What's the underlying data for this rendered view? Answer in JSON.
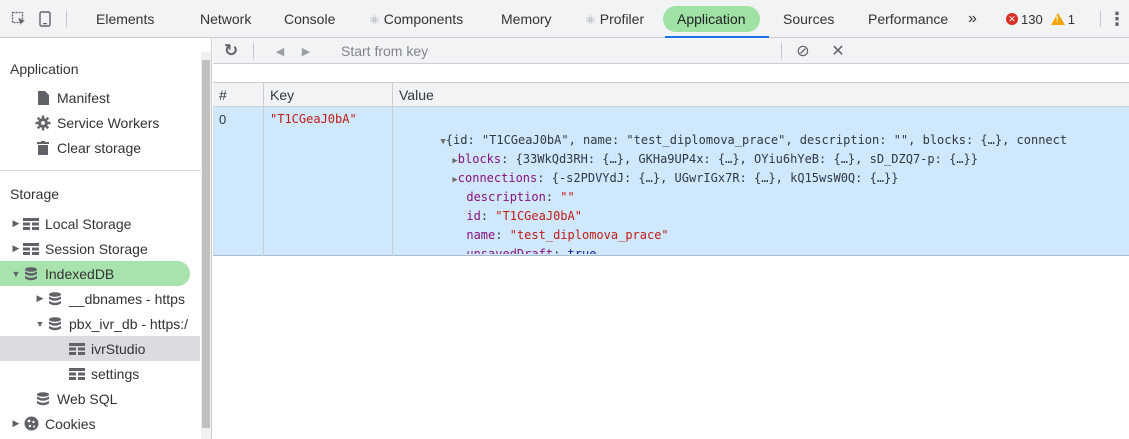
{
  "topbar": {
    "tabs": [
      {
        "label": "Elements"
      },
      {
        "label": "Network"
      },
      {
        "label": "Console"
      },
      {
        "label": "Components",
        "prefix": "⚛"
      },
      {
        "label": "Memory"
      },
      {
        "label": "Profiler",
        "prefix": "⚛"
      },
      {
        "label": "Application",
        "active": true
      },
      {
        "label": "Sources"
      },
      {
        "label": "Performance"
      }
    ],
    "more": "»",
    "errors_count": "130",
    "warnings_count": "1",
    "kebab": "⋮"
  },
  "sidebar": {
    "application_header": "Application",
    "application_items": [
      {
        "label": "Manifest",
        "icon": "file-icon"
      },
      {
        "label": "Service Workers",
        "icon": "gear-icon"
      },
      {
        "label": "Clear storage",
        "icon": "trash-icon"
      }
    ],
    "storage_header": "Storage",
    "storage_items": [
      {
        "label": "Local Storage",
        "icon": "table-icon",
        "arrow": "▶"
      },
      {
        "label": "Session Storage",
        "icon": "table-icon",
        "arrow": "▶"
      },
      {
        "label": "IndexedDB",
        "icon": "database-icon",
        "arrow": "▼",
        "selected": true
      },
      {
        "label": "__dbnames - https",
        "icon": "database-icon",
        "arrow": "▶"
      },
      {
        "label": "pbx_ivr_db - https:/",
        "icon": "database-icon",
        "arrow": "▼"
      },
      {
        "label": "ivrStudio",
        "icon": "table-icon"
      },
      {
        "label": "settings",
        "icon": "table-icon"
      },
      {
        "label": "Web SQL",
        "icon": "database-icon"
      },
      {
        "label": "Cookies",
        "icon": "cookie-icon",
        "arrow": "▶"
      }
    ]
  },
  "toolbar": {
    "refresh_icon": "↻",
    "prev_icon": "◀",
    "next_icon": "▶",
    "key_placeholder": "Start from key",
    "clear_icon": "⊘",
    "delete_icon": "✕"
  },
  "grid": {
    "headers": [
      "#",
      "Key",
      "Value"
    ],
    "row": {
      "index": "0",
      "key": "\"T1CGeaJ0bA\"",
      "value_lines": [
        {
          "arrow": "▼",
          "content": "{id: \"T1CGeaJ0bA\", name: \"test_diplomova_prace\", description: \"\", blocks: {…}, connect"
        },
        {
          "arrow": "▶",
          "prop": "blocks",
          "content": "{33WkQd3RH: {…}, GKHa9UP4x: {…}, OYiu6hYeB: {…}, sD_DZQ7-p: {…}}"
        },
        {
          "arrow": "▶",
          "prop": "connections",
          "content": "{-s2PDVYdJ: {…}, UGwrIGx7R: {…}, kQ15wsW0Q: {…}}"
        },
        {
          "prop": "description",
          "content": "\"\""
        },
        {
          "prop": "id",
          "content": "\"T1CGeaJ0bA\""
        },
        {
          "prop": "name",
          "content": "\"test_diplomova_prace\""
        },
        {
          "prop": "unsavedDraft",
          "content": "true"
        }
      ]
    }
  },
  "colors": {
    "active_tab_bg": "#9fe2a4",
    "selected_row_bg": "#cfe8fc",
    "string_color": "#c41a16",
    "prop_color": "#881280",
    "keyword_color": "#1a1aa6"
  }
}
